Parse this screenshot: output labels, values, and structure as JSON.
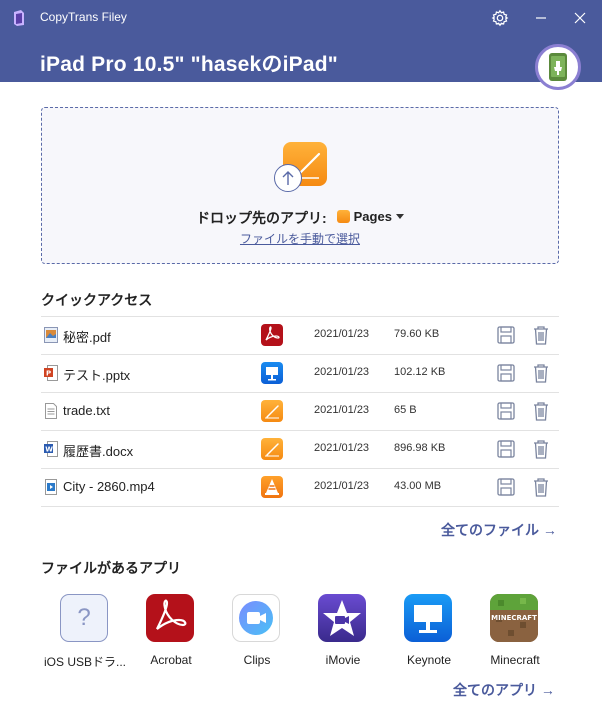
{
  "window": {
    "title": "CopyTrans Filey"
  },
  "header": {
    "device_name": "iPad Pro 10.5\" \"hasekのiPad\""
  },
  "dropzone": {
    "label": "ドロップ先のアプリ:",
    "selected_app": "Pages",
    "manual_link": "ファイルを手動で選択"
  },
  "quick_access": {
    "title": "クイックアクセス",
    "files": [
      {
        "name": "秘密.pdf",
        "app_icon": "acrobat-icon",
        "date": "2021/01/23",
        "size": "79.60 KB"
      },
      {
        "name": "テスト.pptx",
        "app_icon": "keynote-icon",
        "date": "2021/01/23",
        "size": "102.12 KB"
      },
      {
        "name": "trade.txt",
        "app_icon": "pages-icon",
        "date": "2021/01/23",
        "size": "65 B"
      },
      {
        "name": "履歴書.docx",
        "app_icon": "pages-icon",
        "date": "2021/01/23",
        "size": "896.98 KB"
      },
      {
        "name": "City - 2860.mp4",
        "app_icon": "vlc-icon",
        "date": "2021/01/23",
        "size": "43.00 MB"
      }
    ],
    "all_files_link": "全てのファイル →"
  },
  "apps_section": {
    "title": "ファイルがあるアプリ",
    "apps": [
      {
        "label": "iOS USBドラ...",
        "icon": "question-mark-icon"
      },
      {
        "label": "Acrobat",
        "icon": "acrobat-icon"
      },
      {
        "label": "Clips",
        "icon": "clips-icon"
      },
      {
        "label": "iMovie",
        "icon": "imovie-icon"
      },
      {
        "label": "Keynote",
        "icon": "keynote-icon"
      },
      {
        "label": "Minecraft",
        "icon": "minecraft-icon"
      }
    ],
    "all_apps_link": "全てのアプリ →",
    "minecraft_tile_text": "MINECRAFT"
  },
  "colors": {
    "header": "#4a5a9c",
    "accent_link": "#4a5a9c",
    "badge_ring": "#8b7fd2"
  }
}
